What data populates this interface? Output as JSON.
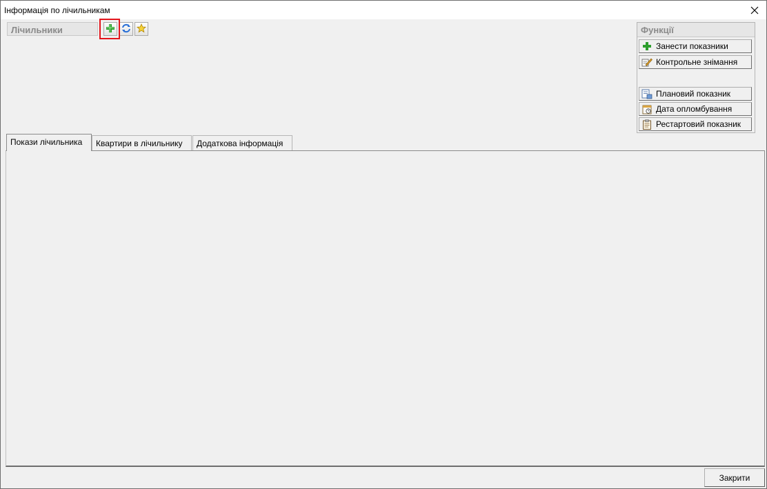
{
  "window": {
    "title": "Інформація по лічильникам"
  },
  "counters": {
    "header": "Лічильники",
    "tools": [
      {
        "name": "add",
        "icon": "plus-icon"
      },
      {
        "name": "refresh",
        "icon": "refresh-icon"
      },
      {
        "name": "favorite",
        "icon": "star-icon"
      }
    ]
  },
  "functions": {
    "header": "Функції",
    "buttons": [
      {
        "label": "Занести показники",
        "icon": "plus-icon"
      },
      {
        "label": "Контрольне знімання",
        "icon": "pencil-icon"
      },
      {
        "label": "Плановий показник",
        "icon": "planned-doc-icon"
      },
      {
        "label": "Дата опломбування",
        "icon": "calendar-icon"
      },
      {
        "label": "Рестартовий показник",
        "icon": "clipboard-icon"
      }
    ]
  },
  "tabs": [
    {
      "label": "Покази лічильника",
      "active": true
    },
    {
      "label": "Квартири в лічильнику",
      "active": false
    },
    {
      "label": "Додаткова інформація",
      "active": false
    }
  ],
  "footer": {
    "close_label": "Закрити"
  },
  "colors": {
    "highlight": "#e3141b",
    "panel_header_text": "#8a8a8a",
    "window_bg": "#f0f0f0"
  }
}
